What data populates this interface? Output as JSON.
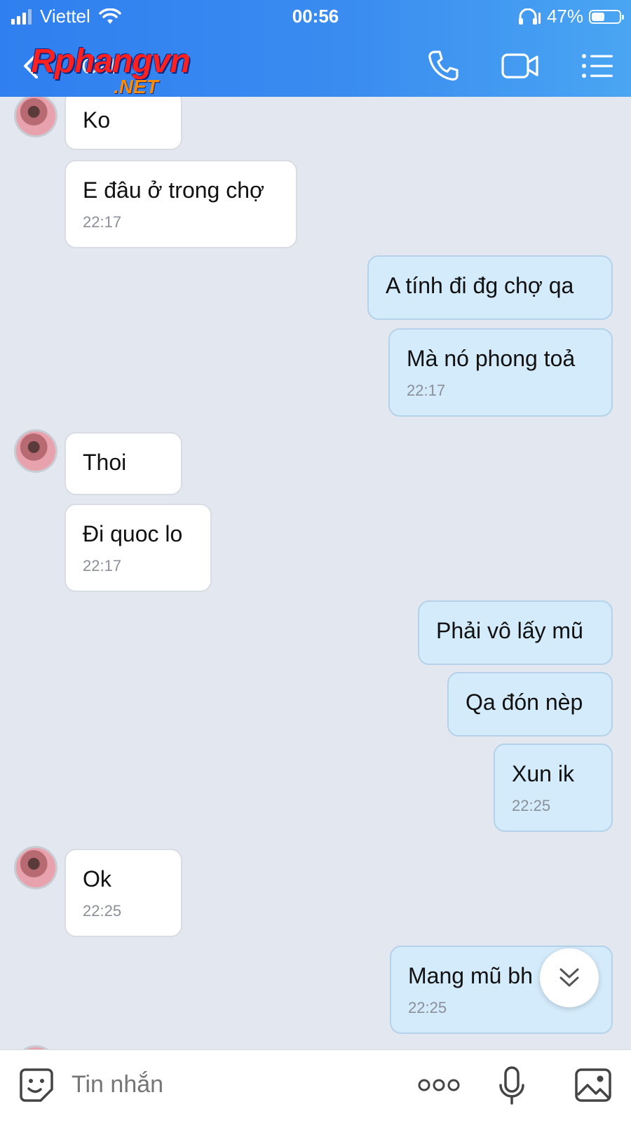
{
  "status_bar": {
    "carrier": "Viettel",
    "time": "00:56",
    "battery": "47%",
    "battery_level": 0.47
  },
  "header": {
    "contact_name": "Cát",
    "watermark_main": "Rphangvn",
    "watermark_sub": ".NET"
  },
  "messages": [
    {
      "dir": "in",
      "text": "Ko",
      "time": ""
    },
    {
      "dir": "in",
      "text": "E đâu ở trong chợ",
      "time": "22:17"
    },
    {
      "dir": "out",
      "text": "A tính đi đg chợ qa",
      "time": ""
    },
    {
      "dir": "out",
      "text": "Mà nó phong toả",
      "time": "22:17"
    },
    {
      "dir": "in",
      "text": "Thoi",
      "time": ""
    },
    {
      "dir": "in",
      "text": "Đi quoc lo",
      "time": "22:17"
    },
    {
      "dir": "out",
      "text": "Phải vô lấy mũ",
      "time": ""
    },
    {
      "dir": "out",
      "text": "Qa đón nèp",
      "time": ""
    },
    {
      "dir": "out",
      "text": "Xun ik",
      "time": "22:25"
    },
    {
      "dir": "in",
      "text": "Ok",
      "time": "22:25"
    },
    {
      "dir": "out",
      "text": "Mang mũ bh",
      "time": "22:25"
    }
  ],
  "composer": {
    "placeholder": "Tin nhắn"
  },
  "icons": {
    "back": "chevron-left-icon",
    "call": "phone-icon",
    "video": "video-camera-icon",
    "menu": "list-icon",
    "sticker": "sticker-icon",
    "more": "more-dots-icon",
    "voice": "microphone-icon",
    "image": "image-icon",
    "scroll": "double-chevron-down-icon"
  },
  "colors": {
    "header": "#3a8cf0",
    "outgoing_bubble": "#d4ebfb",
    "incoming_bubble": "#ffffff",
    "background": "#e3e7ef"
  }
}
